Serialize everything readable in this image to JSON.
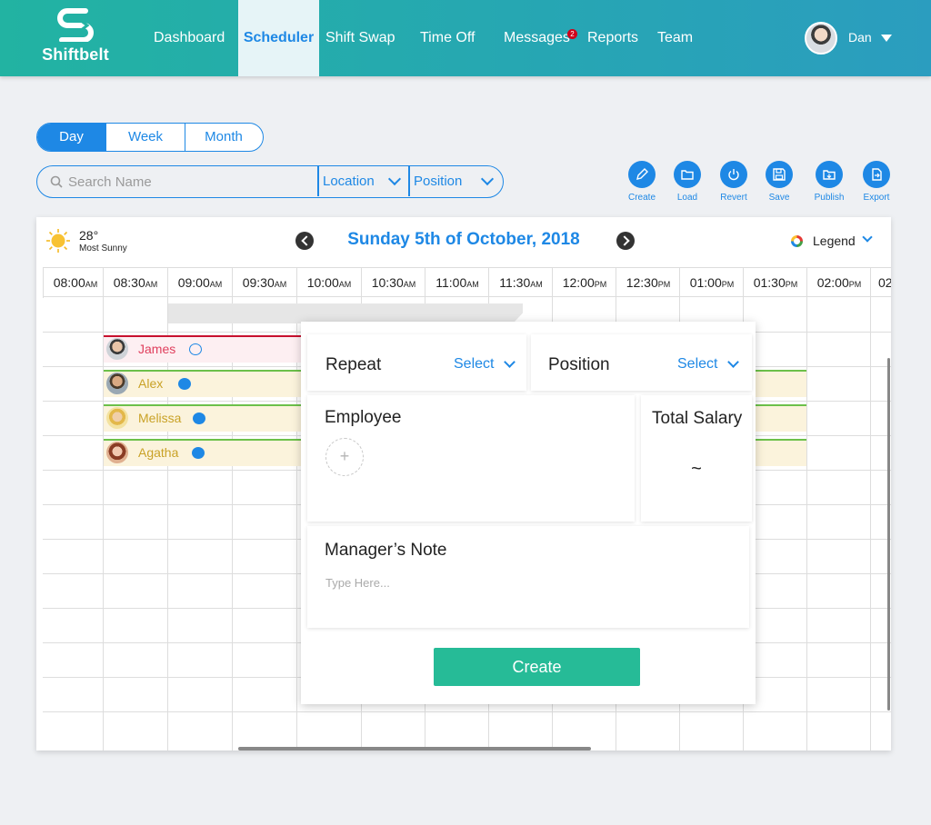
{
  "app": {
    "name": "Shiftbelt",
    "brand_color": "#22b3a2",
    "accent_color": "#1e88e5",
    "logo_icon": "shiftbelt-logo-icon"
  },
  "nav": {
    "items": [
      {
        "label": "Dashboard",
        "active": false
      },
      {
        "label": "Scheduler",
        "active": true
      },
      {
        "label": "Shift Swap",
        "active": false
      },
      {
        "label": "Time Off",
        "active": false
      },
      {
        "label": "Messages",
        "active": false,
        "badge": "2"
      },
      {
        "label": "Reports",
        "active": false
      },
      {
        "label": "Team",
        "active": false
      }
    ],
    "user": {
      "name": "Dan",
      "avatar_icon": "avatar-icon",
      "menu_icon": "caret-down-icon"
    }
  },
  "view_toggle": {
    "options": [
      "Day",
      "Week",
      "Month"
    ],
    "selected": "Day"
  },
  "filters": {
    "search_placeholder": "Search Name",
    "search_value": "",
    "location_label": "Location",
    "position_label": "Position"
  },
  "toolbar": {
    "buttons": [
      {
        "label": "Create",
        "icon": "pencil-icon"
      },
      {
        "label": "Load",
        "icon": "folder-icon"
      },
      {
        "label": "Revert",
        "icon": "power-icon"
      },
      {
        "label": "Save",
        "icon": "floppy-disk-icon"
      },
      {
        "label": "Publish",
        "icon": "folder-upload-icon"
      },
      {
        "label": "Export",
        "icon": "export-icon"
      }
    ]
  },
  "weather": {
    "temperature": "28°",
    "condition": "Most Sunny",
    "icon": "sun-icon"
  },
  "date_nav": {
    "title": "Sunday 5th of October, 2018",
    "prev_icon": "chevron-left-icon",
    "next_icon": "chevron-right-icon"
  },
  "legend": {
    "label": "Legend",
    "icon": "legend-ring-icon"
  },
  "timeline": {
    "hours": [
      {
        "time": "08:00",
        "ampm": "AM"
      },
      {
        "time": "08:30",
        "ampm": "AM"
      },
      {
        "time": "09:00",
        "ampm": "AM"
      },
      {
        "time": "09:30",
        "ampm": "AM"
      },
      {
        "time": "10:00",
        "ampm": "AM"
      },
      {
        "time": "10:30",
        "ampm": "AM"
      },
      {
        "time": "11:00",
        "ampm": "AM"
      },
      {
        "time": "11:30",
        "ampm": "AM"
      },
      {
        "time": "12:00",
        "ampm": "PM"
      },
      {
        "time": "12:30",
        "ampm": "PM"
      },
      {
        "time": "01:00",
        "ampm": "PM"
      },
      {
        "time": "01:30",
        "ampm": "PM"
      },
      {
        "time": "02:00",
        "ampm": "PM"
      },
      {
        "time": "02",
        "ampm": ""
      }
    ],
    "shifts": [
      {
        "name": "James",
        "color": "#e0405e",
        "bar_color": "#fdeff2",
        "line_color": "#c8102e",
        "chat_icon": "chat-bubble-outline-icon"
      },
      {
        "name": "Alex",
        "color": "#c9a227",
        "bar_color": "#fbf3dc",
        "line_color": "#6cc04a",
        "chat_icon": "chat-bubble-icon"
      },
      {
        "name": "Melissa",
        "color": "#c9a227",
        "bar_color": "#fbf3dc",
        "line_color": "#6cc04a",
        "chat_icon": "chat-bubble-icon"
      },
      {
        "name": "Agatha",
        "color": "#c9a227",
        "bar_color": "#fbf3dc",
        "line_color": "#6cc04a",
        "chat_icon": "chat-bubble-icon"
      }
    ]
  },
  "popup": {
    "repeat": {
      "title": "Repeat",
      "value": "Select"
    },
    "position": {
      "title": "Position",
      "value": "Select"
    },
    "employee": {
      "title": "Employee",
      "add_icon": "plus-icon"
    },
    "salary": {
      "title": "Total Salary",
      "value": "~"
    },
    "note": {
      "title": "Manager’s Note",
      "placeholder": "Type Here...",
      "value": ""
    },
    "create_label": "Create",
    "create_color": "#26bb97"
  }
}
